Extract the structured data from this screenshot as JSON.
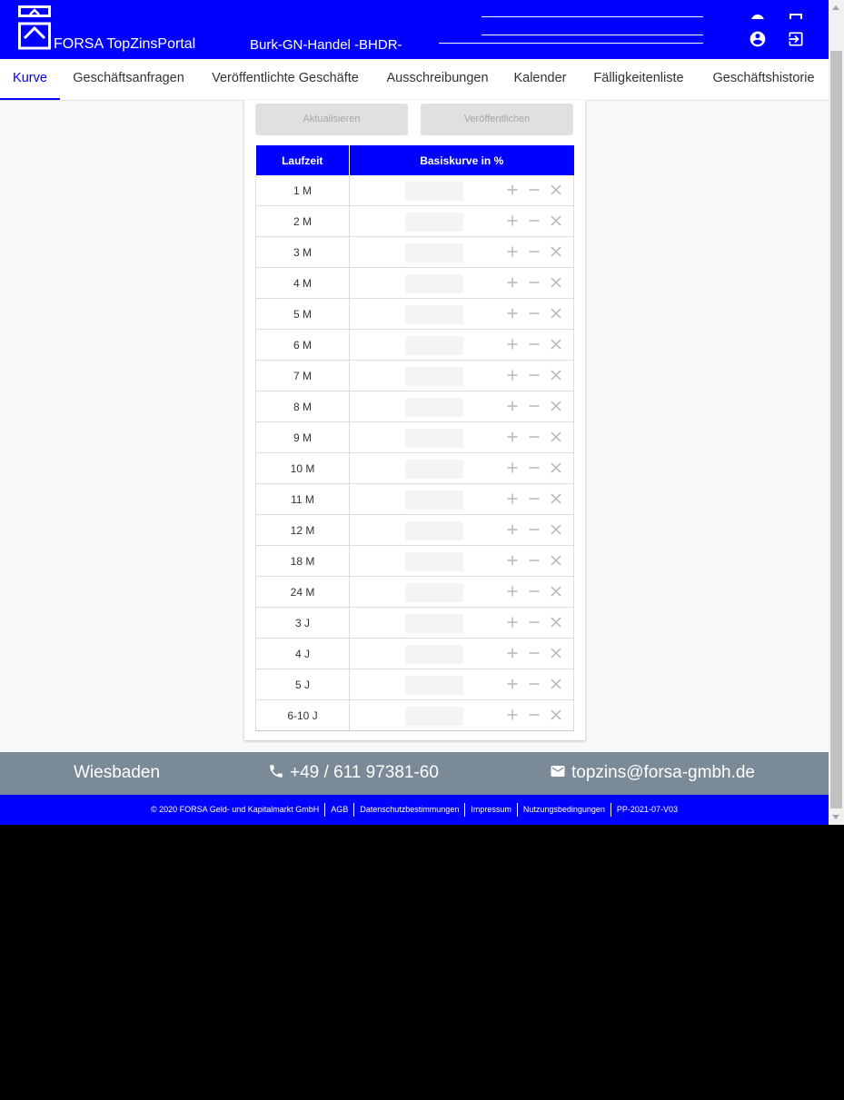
{
  "header": {
    "brand": "FORSA TopZinsPortal",
    "user": "Burk-GN-Handel -BHDR-",
    "icons": [
      "account-circle-icon",
      "logout-icon"
    ]
  },
  "tabs": [
    {
      "label": "Kurve",
      "active": true
    },
    {
      "label": "Geschäftsanfragen",
      "active": false
    },
    {
      "label": "Veröffentlichte Geschäfte",
      "active": false
    },
    {
      "label": "Ausschreibungen",
      "active": false
    },
    {
      "label": "Kalender",
      "active": false
    },
    {
      "label": "Fälligkeitenliste",
      "active": false
    },
    {
      "label": "Geschäftshistorie",
      "active": false
    }
  ],
  "actions": {
    "refresh_label": "Aktualisieren",
    "publish_label": "Veröffentlichen"
  },
  "table": {
    "columns": [
      "Laufzeit",
      "Basiskurve in %"
    ],
    "rows": [
      "1 M",
      "2 M",
      "3 M",
      "4 M",
      "5 M",
      "6 M",
      "7 M",
      "8 M",
      "9 M",
      "10 M",
      "11 M",
      "12 M",
      "18 M",
      "24 M",
      "3 J",
      "4 J",
      "5 J",
      "6-10 J"
    ]
  },
  "footer": {
    "city": "Wiesbaden",
    "phone": "+49 / 611 97381-60",
    "email": "topzins@forsa-gmbh.de",
    "legal": [
      "© 2020 FORSA Geld- und Kapitalmarkt GmbH",
      "AGB",
      "Datenschutzbestimmungen",
      "Impressum",
      "Nutzungsbedingungen",
      "PP-2021-07-V03"
    ]
  },
  "colors": {
    "primary": "#0000ff",
    "footer_bg": "#7b8a97",
    "disabled_button": "#e0e0e0",
    "disabled_text": "#a6a6a6",
    "action_icon": "#b4b4b4"
  }
}
